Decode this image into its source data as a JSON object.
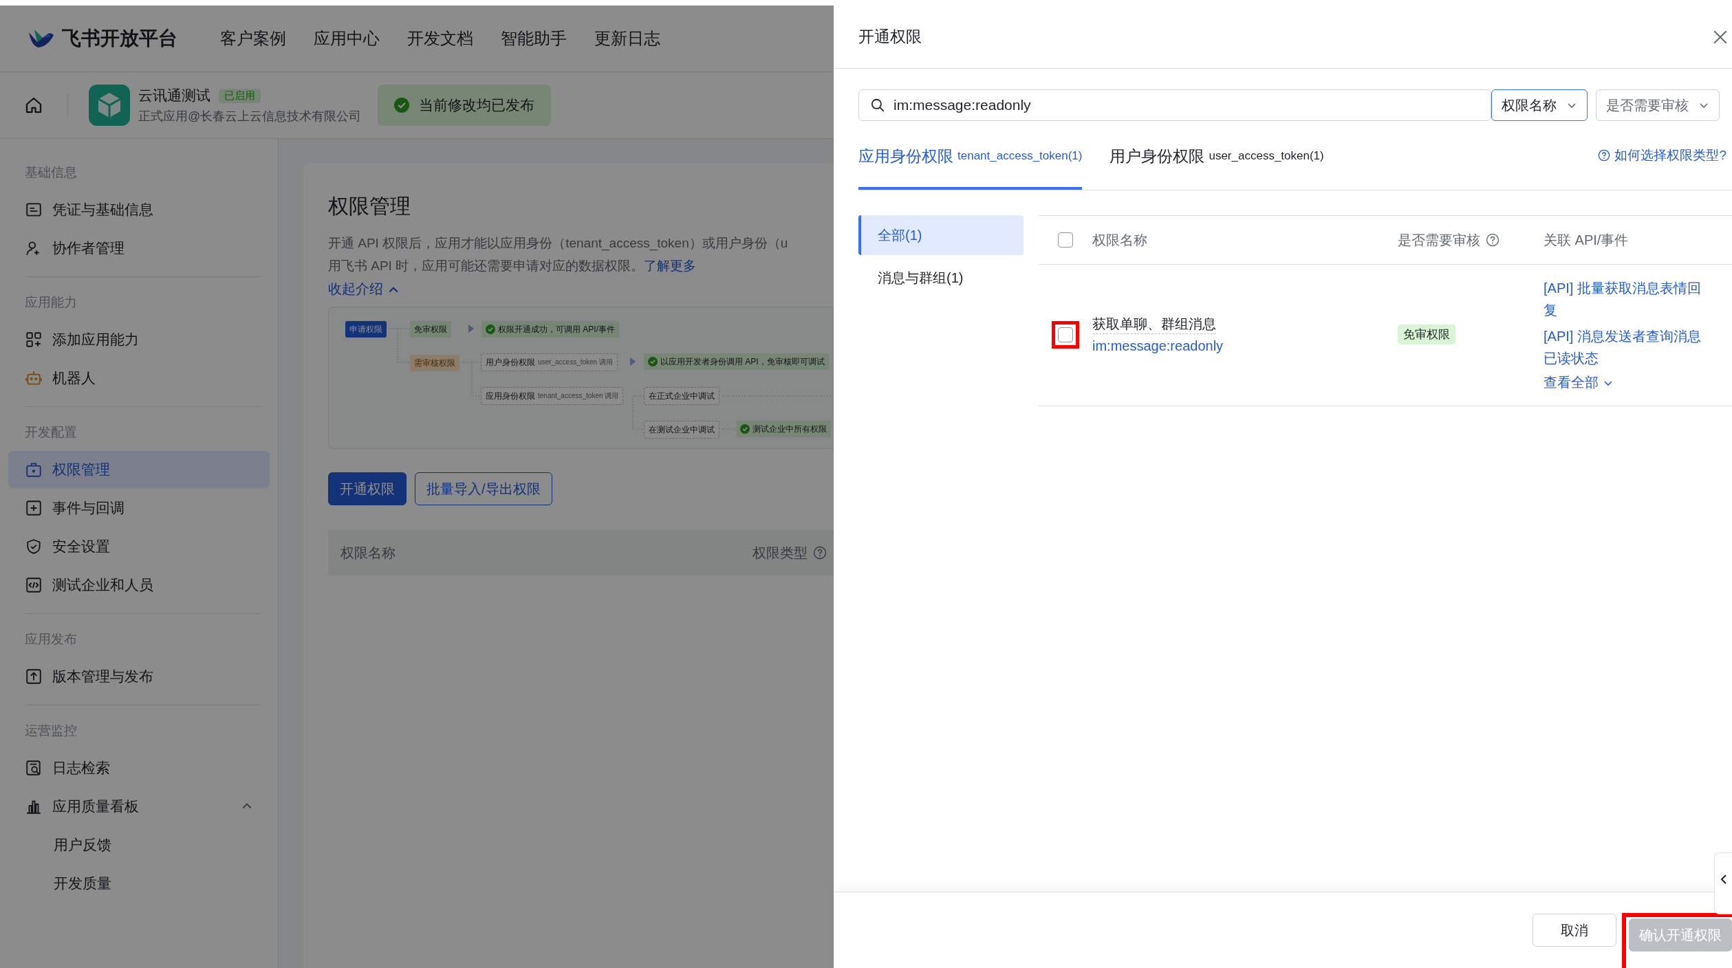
{
  "header": {
    "brand": "飞书开放平台",
    "nav": [
      "客户案例",
      "应用中心",
      "开发文档",
      "智能助手",
      "更新日志"
    ]
  },
  "app_bar": {
    "app_name": "云讯通测试",
    "status_badge": "已启用",
    "subtitle": "正式应用@长春云上云信息技术有限公司",
    "publish_status": "当前修改均已发布"
  },
  "sidebar": {
    "groups": [
      {
        "title": "基础信息",
        "items": [
          {
            "label": "凭证与基础信息",
            "selected": false
          },
          {
            "label": "协作者管理",
            "selected": false
          }
        ]
      },
      {
        "title": "应用能力",
        "items": [
          {
            "label": "添加应用能力",
            "selected": false
          },
          {
            "label": "机器人",
            "selected": false
          }
        ]
      },
      {
        "title": "开发配置",
        "items": [
          {
            "label": "权限管理",
            "selected": true
          },
          {
            "label": "事件与回调",
            "selected": false
          },
          {
            "label": "安全设置",
            "selected": false
          },
          {
            "label": "测试企业和人员",
            "selected": false
          }
        ]
      },
      {
        "title": "应用发布",
        "items": [
          {
            "label": "版本管理与发布",
            "selected": false
          }
        ]
      },
      {
        "title": "运营监控",
        "items": [
          {
            "label": "日志检索",
            "selected": false
          },
          {
            "label": "应用质量看板",
            "selected": false,
            "expanded": true,
            "children": [
              {
                "label": "用户反馈",
                "selected": false
              },
              {
                "label": "开发质量",
                "selected": false
              }
            ]
          }
        ]
      }
    ]
  },
  "content": {
    "title": "权限管理",
    "description_lines": [
      "开通 API 权限后，应用才能以应用身份（tenant_access_token）或用户身份（u",
      "用飞书 API 时，应用可能还需要申请对应的数据权限。"
    ],
    "learn_more": "了解更多",
    "collapse_link": "收起介绍",
    "diagram": {
      "nodes": [
        {
          "kind": "start",
          "label": "申请权限"
        },
        {
          "kind": "free",
          "label": "免审权限"
        },
        {
          "kind": "success",
          "label": "权限开通成功，可调用 API/事件"
        },
        {
          "kind": "review",
          "label": "需审核权限"
        },
        {
          "kind": "plain",
          "label": "用户身份权限",
          "sub": "user_access_token 调用"
        },
        {
          "kind": "success",
          "label": "以应用开发者身份调用 API，免审核即可调试"
        },
        {
          "kind": "plain",
          "label": "应用身份权限",
          "sub": "tenant_access_token 调用"
        },
        {
          "kind": "plain",
          "label": "在正式企业中调试"
        },
        {
          "kind": "plain",
          "label": "在测试企业中调试"
        },
        {
          "kind": "success",
          "label": "测试企业中所有权限"
        }
      ]
    },
    "buttons": [
      {
        "kind": "primary",
        "label": "开通权限"
      },
      {
        "kind": "outline",
        "label": "批量导入/导出权限"
      }
    ],
    "table_columns": [
      "权限名称",
      "权限类型"
    ]
  },
  "drawer": {
    "title": "开通权限",
    "search": {
      "value": "im:message:readonly"
    },
    "filters": [
      {
        "label": "权限名称",
        "focused": true
      },
      {
        "label": "是否需要审核",
        "focused": false
      }
    ],
    "tabs": [
      {
        "label": "应用身份权限",
        "token": "tenant_access_token(1)",
        "selected": true
      },
      {
        "label": "用户身份权限",
        "token": "user_access_token(1)",
        "selected": false
      }
    ],
    "help_link": "如何选择权限类型?",
    "categories": [
      {
        "label": "全部(1)",
        "selected": true
      },
      {
        "label": "消息与群组(1)",
        "selected": false
      }
    ],
    "table": {
      "select_all_checked": false,
      "columns": [
        "权限名称",
        "是否需要审核",
        "关联 API/事件"
      ],
      "rows": [
        {
          "checked": false,
          "highlighted": true,
          "name": "获取单聊、群组消息",
          "code": "im:message:readonly",
          "review": "免审权限",
          "apis": [
            "[API] 批量获取消息表情回复",
            "[API] 消息发送者查询消息已读状态"
          ],
          "view_all": "查看全部"
        }
      ]
    },
    "cancel": "取消",
    "confirm": {
      "label": "确认开通权限",
      "disabled": true,
      "highlighted": true
    }
  }
}
